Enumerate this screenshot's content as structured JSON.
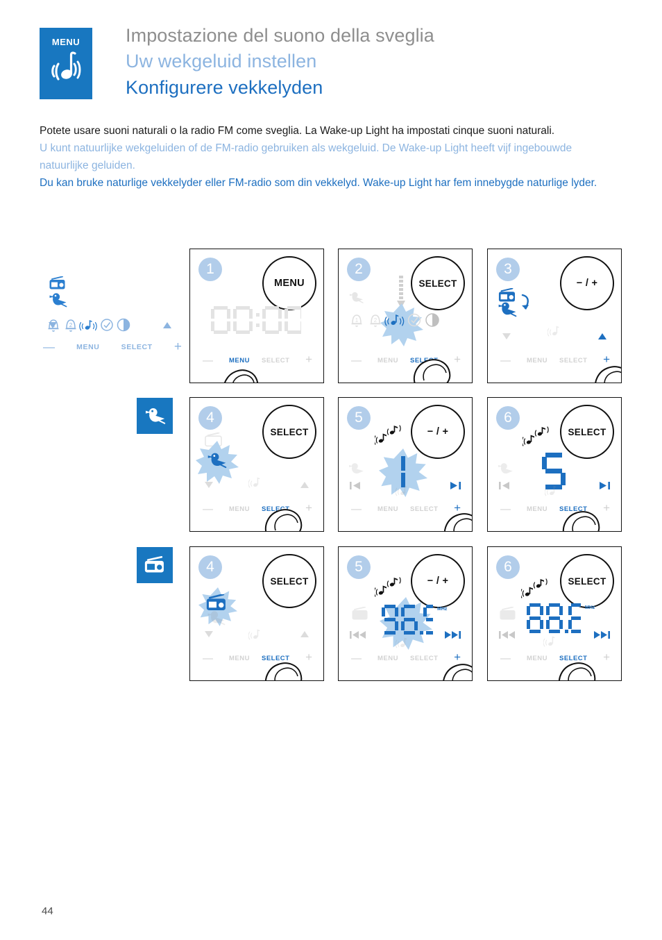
{
  "header": {
    "badge_label": "MENU",
    "badge_icon": "music-note-waves-icon",
    "title_it": "Impostazione del suono della sveglia",
    "title_nl": "Uw wekgeluid instellen",
    "title_no": "Konfigurere vekkelyden"
  },
  "body": {
    "paragraph_it": "Potete usare suoni naturali o la radio FM come sveglia. La Wake-up Light ha impostati cinque suoni naturali.",
    "paragraph_nl": "U kunt natuurlijke wekgeluiden of de FM-radio gebruiken als wekgeluid. De Wake-up Light heeft vijf ingebouwde natuurlijke geluiden.",
    "paragraph_no": "Du kan bruke naturlige vekkelyder eller FM-radio som din vekkelyd. Wake-up Light har fem innebygde naturlige lyder."
  },
  "legend": {
    "radio_icon": "radio-icon",
    "bird_icon": "bird-icon",
    "icons": [
      "alarm-1-icon",
      "alarm-2-icon",
      "music-note-icon",
      "check-circle-icon",
      "brightness-icon"
    ],
    "down_triangle": "triangle-down-icon",
    "up_triangle": "triangle-up-icon",
    "minus": "—",
    "menu_label": "MENU",
    "select_label": "SELECT",
    "plus": "+"
  },
  "row_badges": {
    "row2_icon": "bird-icon",
    "row3_icon": "radio-icon"
  },
  "controls": {
    "minus": "—",
    "plus": "+",
    "menu_label": "MENU",
    "select_label": "SELECT"
  },
  "panels": [
    {
      "step": "1",
      "button_label": "MENU",
      "display": "00:00",
      "display_state": "inactive",
      "highlight": "menu",
      "hand": true,
      "hand_pos": "left"
    },
    {
      "step": "2",
      "button_label": "SELECT",
      "status_icons": [
        "alarm-1-icon",
        "alarm-2-icon",
        "music-note-icon",
        "check-circle-icon",
        "brightness-icon"
      ],
      "active_icon": "music-note-icon",
      "burst": true,
      "down_arrow": true,
      "highlight": "select",
      "hand": true,
      "hand_pos": "right"
    },
    {
      "step": "3",
      "button_label": "− / +",
      "source_icons": [
        "radio-icon",
        "bird-icon"
      ],
      "cycle_arrow": true,
      "up_triangle_active": true,
      "highlight": "plus",
      "hand": true,
      "hand_pos": "far-right"
    },
    {
      "step": "4",
      "button_label": "SELECT",
      "active_icon": "bird-icon",
      "dim_icon": "radio-icon",
      "burst": true,
      "highlight": "select",
      "hand": true,
      "hand_pos": "right"
    },
    {
      "step": "5",
      "button_label": "− / +",
      "display": "1",
      "notes_icon": "music-notes-icon",
      "burst": true,
      "skip_prev": "⏮",
      "skip_next": "⏭",
      "highlight": "plus",
      "hand": true,
      "hand_pos": "far-right"
    },
    {
      "step": "6",
      "button_label": "SELECT",
      "display": "5",
      "notes_icon": "music-notes-icon",
      "skip_prev": "⏮",
      "skip_next": "⏭",
      "highlight": "select",
      "hand": true,
      "hand_pos": "right"
    },
    {
      "step": "4",
      "button_label": "SELECT",
      "active_icon": "radio-icon",
      "dim_icon": "bird-icon",
      "burst": true,
      "highlight": "select",
      "hand": true,
      "hand_pos": "right"
    },
    {
      "step": "5",
      "button_label": "− / +",
      "display": "96.9",
      "unit": "MHz",
      "notes_icon": "music-notes-icon",
      "burst": true,
      "skip_prev": "⏪",
      "skip_next": "⏩",
      "highlight": "plus",
      "hand": true,
      "hand_pos": "far-right"
    },
    {
      "step": "6",
      "button_label": "SELECT",
      "display": "88.6",
      "unit": "MHz",
      "notes_icon": "music-notes-icon",
      "skip_prev": "⏪",
      "skip_next": "⏩",
      "highlight": "select",
      "hand": true,
      "hand_pos": "right"
    }
  ],
  "footer": {
    "page_number": "44"
  },
  "colors": {
    "brand_blue": "#1877c0",
    "accent_blue": "#1d6fc0",
    "light_blue": "#8cb4e0",
    "burst_blue": "#b2d2ee",
    "badge_blue": "#b2cdea",
    "grey_title": "#8e8e8e",
    "dim_grey": "#d2d2d2"
  }
}
